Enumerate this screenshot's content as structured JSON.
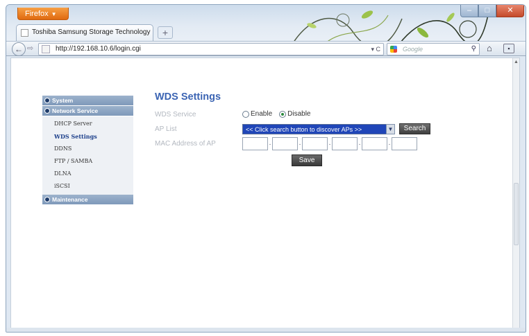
{
  "browser": {
    "menu_button": "Firefox",
    "tab_title": "Toshiba Samsung Storage Technology",
    "url": "http://192.168.10.6/login.cgi",
    "search_placeholder": "Google",
    "new_tab_label": "+"
  },
  "sidebar": {
    "sections": [
      {
        "label": "System",
        "items": []
      },
      {
        "label": "Network Service",
        "items": [
          "DHCP Server",
          "WDS Settings",
          "DDNS",
          "FTP / SAMBA",
          "DLNA",
          "iSCSI"
        ]
      },
      {
        "label": "Maintenance",
        "items": []
      }
    ],
    "active_item": "WDS Settings"
  },
  "main": {
    "title": "WDS Settings",
    "wds_service": {
      "label": "WDS Service",
      "options": [
        "Enable",
        "Disable"
      ],
      "selected": "Disable"
    },
    "ap_list": {
      "label": "AP List",
      "selected_text": "<< Click search button to discover APs >>",
      "search_button": "Search"
    },
    "mac_address": {
      "label": "MAC Address of AP",
      "fields": [
        "",
        "",
        "",
        "",
        "",
        ""
      ]
    },
    "save_button": "Save"
  },
  "colors": {
    "title": "#3b64b3",
    "nav_section_bg": "#8fa6c4",
    "select_bg": "#2046b8",
    "button_bg": "#4a4a4a"
  }
}
